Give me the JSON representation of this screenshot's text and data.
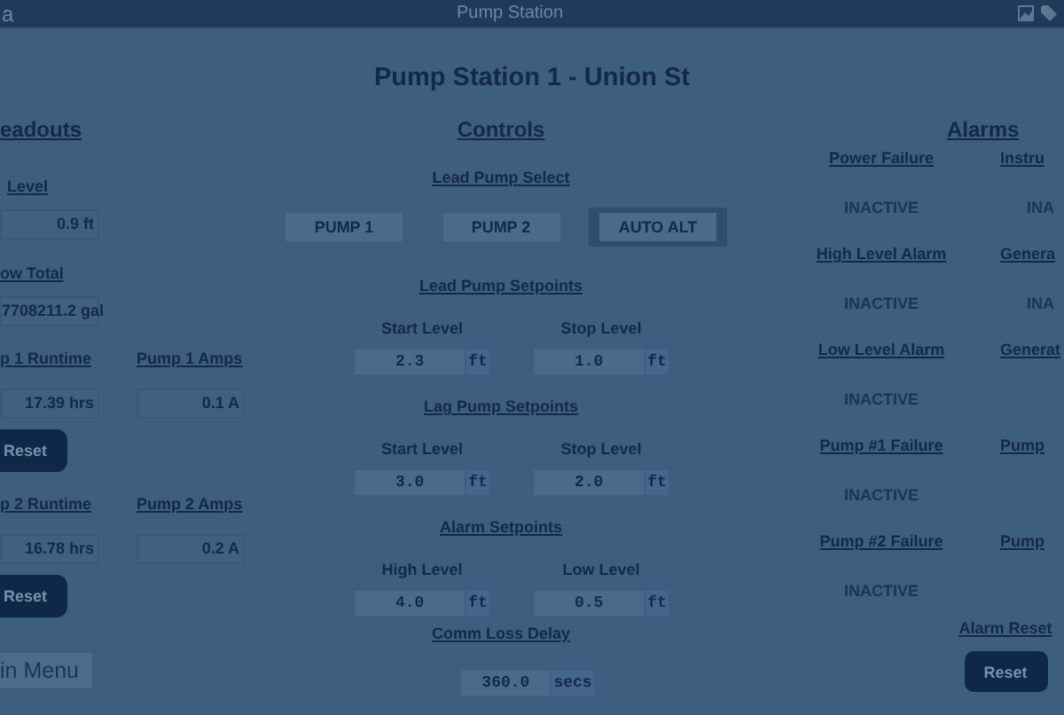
{
  "top_bar": {
    "logo_text": "a",
    "title": "Pump Station"
  },
  "heading": "Pump Station 1 - Union St",
  "readouts": {
    "title": "eadouts",
    "items": [
      {
        "label": "Level",
        "value": "0.9 ft"
      },
      {
        "label": "ow Total",
        "value": "7708211.2 gal"
      }
    ],
    "pumps": [
      {
        "runtime_label": "p 1 Runtime",
        "runtime": "17.39 hrs",
        "amps_label": "Pump 1 Amps",
        "amps": "0.1 A",
        "reset": "Reset"
      },
      {
        "runtime_label": "p 2 Runtime",
        "runtime": "16.78 hrs",
        "amps_label": "Pump 2 Amps",
        "amps": "0.2 A",
        "reset": "Reset"
      }
    ],
    "main_menu": "in Menu"
  },
  "controls": {
    "title": "Controls",
    "lead_select": {
      "title": "Lead Pump Select",
      "options": [
        {
          "label": "PUMP 1",
          "selected": false
        },
        {
          "label": "PUMP 2",
          "selected": false
        },
        {
          "label": "AUTO ALT",
          "selected": true
        }
      ]
    },
    "setpoint_groups": [
      {
        "title": "Lead Pump Setpoints",
        "fields": [
          {
            "label": "Start Level",
            "value": "2.3",
            "unit": "ft"
          },
          {
            "label": "Stop Level",
            "value": "1.0",
            "unit": "ft"
          }
        ]
      },
      {
        "title": "Lag Pump Setpoints",
        "fields": [
          {
            "label": "Start Level",
            "value": "3.0",
            "unit": "ft"
          },
          {
            "label": "Stop Level",
            "value": "2.0",
            "unit": "ft"
          }
        ]
      },
      {
        "title": "Alarm Setpoints",
        "fields": [
          {
            "label": "High Level",
            "value": "4.0",
            "unit": "ft"
          },
          {
            "label": "Low Level",
            "value": "0.5",
            "unit": "ft"
          }
        ]
      }
    ],
    "comm_loss": {
      "label": "Comm Loss Delay",
      "value": "360.0",
      "unit": "secs"
    }
  },
  "alarms": {
    "title": "Alarms",
    "column_1": [
      {
        "label": "Power Failure",
        "status": "INACTIVE"
      },
      {
        "label": "High Level Alarm",
        "status": "INACTIVE"
      },
      {
        "label": "Low Level Alarm",
        "status": "INACTIVE"
      },
      {
        "label": "Pump #1 Failure",
        "status": "INACTIVE"
      },
      {
        "label": "Pump #2 Failure",
        "status": "INACTIVE"
      }
    ],
    "column_2": [
      {
        "label": "Instru",
        "status": "INA"
      },
      {
        "label": "Genera",
        "status": "INA"
      },
      {
        "label": "Generat"
      },
      {
        "label": "Pump"
      },
      {
        "label": "Pump"
      }
    ],
    "reset_label": "Alarm Reset",
    "reset_button": "Reset"
  }
}
